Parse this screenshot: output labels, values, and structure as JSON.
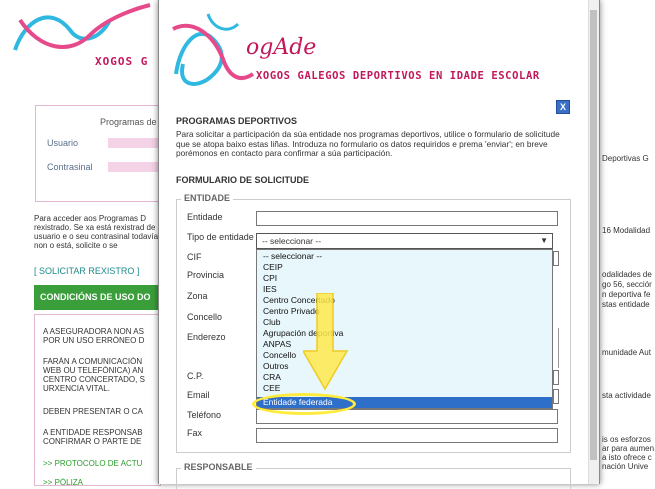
{
  "background": {
    "logo_tagline": "XOGOS G",
    "login_title": "Programas de",
    "usuario_label": "Usuario",
    "contrasinal_label": "Contrasinal",
    "help_text": "Para acceder aos Programas D rexistrado. Se xa está rexistrad de usuario e o seu contrasinal todavía non o está, solicite o se",
    "register_link": "[ SOLICITAR REXISTRO ]",
    "conditions_header": "CONDICIÓNS DE USO DO",
    "conditions": [
      "A ASEGURADORA NON AS",
      "POR UN USO ERRÓNEO D",
      "FARÁN A COMUNICACIÓN",
      "WEB OU TELEFÓNICA) AN",
      "CENTRO CONCERTADO, S",
      "URXENCIA VITAL.",
      "DEBEN PRESENTAR O CA",
      "A ENTIDADE RESPONSAB",
      "CONFIRMAR O PARTE DE",
      ">> PROTOCOLO DE ACTU",
      ">> PÓLIZA"
    ],
    "right_snippets": [
      "Deportivas G",
      "16 Modalidad",
      "odalidades de",
      "go 56, secciór",
      "n deportiva fe",
      "stas entidade",
      "munidade Aut",
      "sta actividade",
      "is os esforzos",
      "ar para aumen",
      "a isto ofrece c",
      "nación Unive"
    ]
  },
  "modal": {
    "tagline": "XOGOS GALEGOS DEPORTIVOS EN IDADE ESCOLAR",
    "close_label": "X",
    "section_title": "PROGRAMAS DEPORTIVOS",
    "intro": "Para solicitar a participación da súa entidade nos programas deportivos, utilice o formulario de solicitude que se atopa baixo estas liñas. Introduza no formulario os datos requiridos e prema 'enviar'; en breve porémonos en contacto para confirmar a súa participación.",
    "form_title": "FORMULARIO DE SOLICITUDE",
    "legend_entidade": "ENTIDADE",
    "legend_responsable": "RESPONSABLE",
    "fields": {
      "entidade": "Entidade",
      "tipo": "Tipo de entidade",
      "cif": "CIF",
      "provincia": "Provincia",
      "zona": "Zona",
      "concello": "Concello",
      "enderezo": "Enderezo",
      "cp": "C.P.",
      "email": "Email",
      "telefono": "Teléfono",
      "fax": "Fax"
    },
    "select_value": "-- seleccionar --",
    "options": [
      "-- seleccionar --",
      "CEIP",
      "CPI",
      "IES",
      "Centro Concertado",
      "Centro Privado",
      "Club",
      "Agrupación deportiva",
      "ANPAS",
      "Concello",
      "Outros",
      "CRA",
      "CEE"
    ],
    "selected_option": "Entidade federada"
  },
  "colors": {
    "accent_pink": "#c2185b",
    "highlight_yellow": "#ffeb3b",
    "selection_blue": "#2e6fc9",
    "green_header": "#3a9e3a"
  }
}
